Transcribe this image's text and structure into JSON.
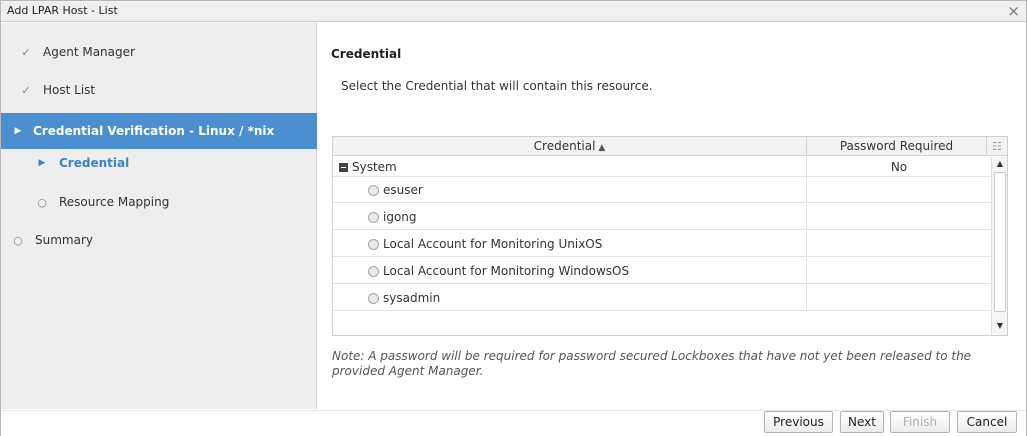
{
  "dialog": {
    "title": "Add LPAR Host - List",
    "close_glyph": "×"
  },
  "steps": [
    {
      "label": "Agent Manager",
      "marker": "✓",
      "state": "done"
    },
    {
      "label": "Host List",
      "marker": "✓",
      "state": "done"
    },
    {
      "label": "Credential Verification - Linux / *nix",
      "marker": "▶",
      "state": "active"
    },
    {
      "label": "Credential",
      "marker": "▶",
      "state": "active-sub"
    },
    {
      "label": "Resource Mapping",
      "marker": "○",
      "state": "pending"
    },
    {
      "label": "Summary",
      "marker": "○",
      "state": "pending"
    }
  ],
  "main": {
    "heading": "Credential",
    "description": "Select the Credential that will contain this resource."
  },
  "grid": {
    "columns": {
      "credential": "Credential",
      "sort_indicator": "▲",
      "password_required": "Password Required",
      "menu_glyph": "☷"
    },
    "group": {
      "name": "System",
      "password_required": "No"
    },
    "rows": [
      {
        "name": "esuser",
        "password_required": ""
      },
      {
        "name": "igong",
        "password_required": ""
      },
      {
        "name": "Local Account for Monitoring UnixOS",
        "password_required": ""
      },
      {
        "name": "Local Account for Monitoring WindowsOS",
        "password_required": ""
      },
      {
        "name": "sysadmin",
        "password_required": ""
      }
    ],
    "scroll_up": "▲",
    "scroll_down": "▼"
  },
  "note": "Note: A password will be required for password secured Lockboxes that have not yet been released to the provided Agent Manager.",
  "buttons": {
    "previous": "Previous",
    "next": "Next",
    "finish": "Finish",
    "cancel": "Cancel"
  },
  "colors": {
    "active_step_bg": "#4a90d0",
    "active_substep_text": "#3a83c5",
    "sidebar_bg": "#eeeeee"
  }
}
